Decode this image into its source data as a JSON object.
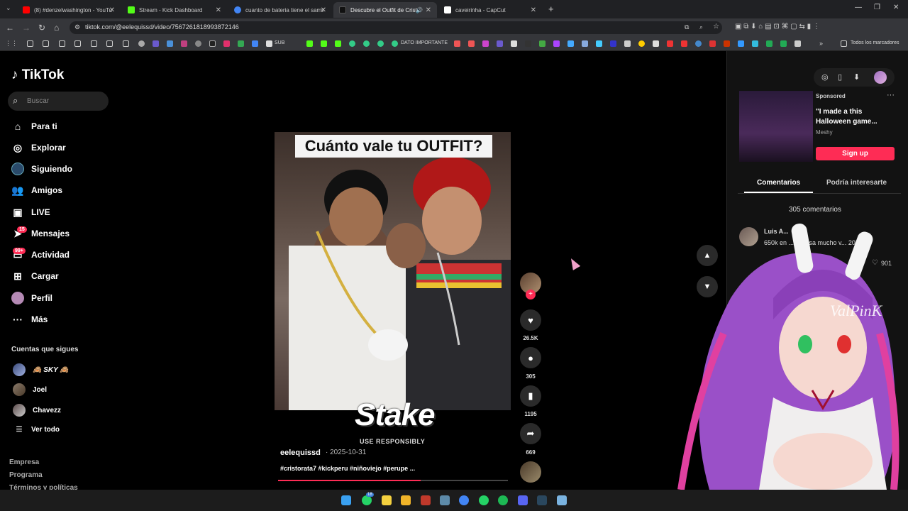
{
  "browser": {
    "tabs": [
      {
        "label": "(8) #denzelwashington - YouTube",
        "color": "#ff0000"
      },
      {
        "label": "Stream - Kick Dashboard",
        "color": "#53fc18"
      },
      {
        "label": "cuanto de bateria tiene el sams",
        "color": "#4285f4"
      },
      {
        "label": "Descubre el Outfit de Cristo",
        "color": "#111111"
      },
      {
        "label": "caveirinha - CapCut",
        "color": "#ffffff"
      }
    ],
    "new_tab": "+",
    "url": "tiktok.com/@eelequissd/video/7567261818993872146",
    "bookmarks_sub": "SUB",
    "bookmarks_dato": "DATO IMPORTANTE",
    "bookmarks_all": "Todos los marcadores"
  },
  "sidebar": {
    "logo": "TikTok",
    "search_placeholder": "Buscar",
    "items": [
      {
        "label": "Para ti",
        "icon": "home-icon"
      },
      {
        "label": "Explorar",
        "icon": "compass-icon"
      },
      {
        "label": "Siguiendo",
        "icon": "following-icon"
      },
      {
        "label": "Amigos",
        "icon": "friends-icon"
      },
      {
        "label": "LIVE",
        "icon": "live-icon"
      },
      {
        "label": "Mensajes",
        "icon": "messages-icon",
        "badge": "15"
      },
      {
        "label": "Actividad",
        "icon": "activity-icon",
        "badge": "99+"
      },
      {
        "label": "Cargar",
        "icon": "upload-icon"
      },
      {
        "label": "Perfil",
        "icon": "profile-icon"
      },
      {
        "label": "Más",
        "icon": "more-icon"
      }
    ],
    "following_title": "Cuentas que sigues",
    "following": [
      "🙈 SKY 🙈",
      "Joel",
      "Chavezz"
    ],
    "see_all": "Ver todo",
    "footer": [
      "Empresa",
      "Programa",
      "Términos y políticas"
    ]
  },
  "video": {
    "overlay_title": "Cuánto vale tu OUTFIT?",
    "stake": "Stake",
    "responsibly": "USE RESPONSIBLY",
    "author": "eelequissd",
    "date": "· 2025-10-31",
    "tags": "#cristorata7 #kickperu #niñoviejo #perupe ...",
    "progress": 0.62
  },
  "actions": {
    "likes": "26.5K",
    "comments": "305",
    "saves": "1195",
    "shares": "669"
  },
  "ad": {
    "sponsored": "Sponsored",
    "title": "\"I made a this Halloween game...",
    "brand": "Meshy",
    "signup": "Sign up"
  },
  "comments_panel": {
    "tab_comments": "Comentarios",
    "tab_interest": "Podría interesarte",
    "count": "305 comentarios",
    "first": {
      "name": "Luis A...",
      "text": "650k en ...ios, esa mucho v... 20!",
      "likes": "901"
    }
  },
  "colors": {
    "accent": "#fe2c55",
    "background": "#000000"
  }
}
